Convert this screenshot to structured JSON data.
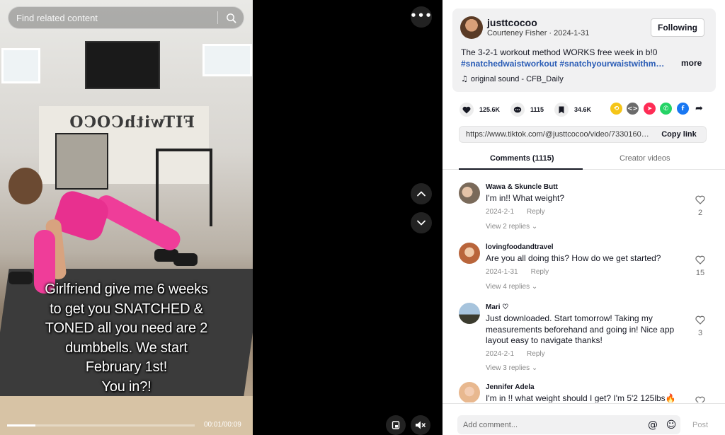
{
  "search": {
    "placeholder": "Find related content"
  },
  "video": {
    "caption_lines": [
      "Girlfriend give me 6 weeks",
      "to get you SNATCHED &",
      "TONED all you need are 2",
      "dumbbells. We start",
      "February 1st!",
      "You in?!"
    ],
    "wall_text": "FITwithCOCO",
    "timecode": "00:01/00:09",
    "progress": 0.15
  },
  "post": {
    "username": "justtcocoo",
    "display_name": "Courteney Fisher",
    "date": "2024-1-31",
    "subline_sep": " · ",
    "follow_label": "Following",
    "description": "The 3-2-1 workout method WORKS free week in b!0",
    "hashtags": "#snatchedwaistworkout #snatchyourwaistwithme...",
    "more_label": "more",
    "sound": "original sound - CFB_Daily"
  },
  "actions": {
    "likes": "125.6K",
    "comments": "1115",
    "saves": "34.6K"
  },
  "link": {
    "url": "https://www.tiktok.com/@justtcocoo/video/73301603...",
    "copy_label": "Copy link"
  },
  "tabs": {
    "comments": "Comments (1115)",
    "creator": "Creator videos"
  },
  "comments": [
    {
      "name": "Wawa & Skuncle Butt",
      "text": "I'm in!! What weight?",
      "date": "2024-2-1",
      "reply": "Reply",
      "replies": "View 2 replies",
      "likes": "2"
    },
    {
      "name": "lovingfoodandtravel",
      "text": "Are you all doing this? How do we get started?",
      "date": "2024-1-31",
      "reply": "Reply",
      "replies": "View 4 replies",
      "likes": "15"
    },
    {
      "name": "Mari ♡",
      "text": "Just downloaded. Start tomorrow! Taking my measurements beforehand and going in! Nice app layout easy to navigate thanks!",
      "date": "2024-2-1",
      "reply": "Reply",
      "replies": "View 3 replies",
      "likes": "3"
    },
    {
      "name": "Jennifer Adela",
      "text": "I'm in !! what weight should I get? I'm 5'2 125lbs🔥",
      "date": "",
      "reply": "",
      "replies": "",
      "likes": ""
    }
  ],
  "composer": {
    "placeholder": "Add comment...",
    "post_label": "Post",
    "mention_icon": "@"
  },
  "colors": {
    "accent_link": "#2b5db6",
    "tiktok_pink": "#fe2c55",
    "outfit_pink": "#ef3d99"
  }
}
